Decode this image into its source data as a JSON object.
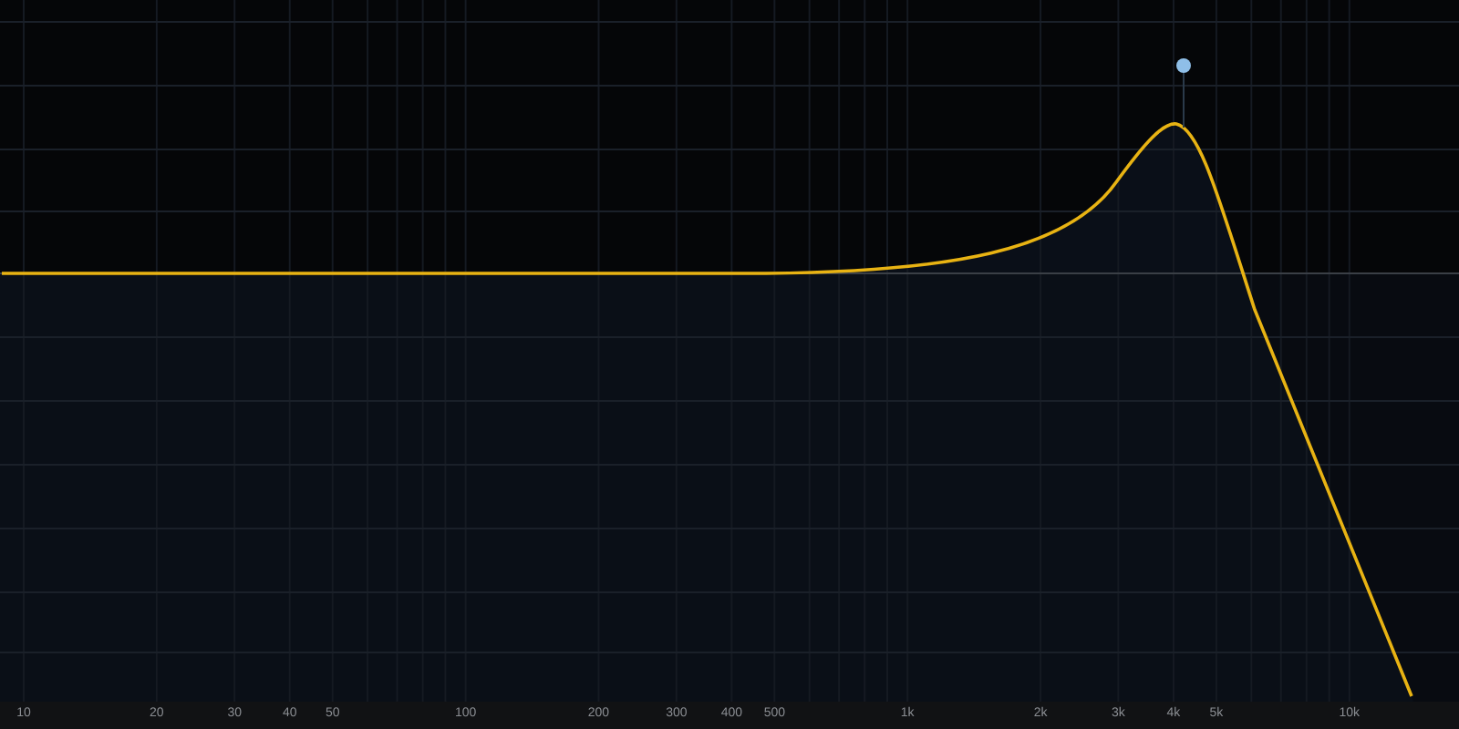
{
  "frequency_axis": {
    "labels": [
      "10",
      "20",
      "30",
      "40",
      "50",
      "100",
      "200",
      "300",
      "400",
      "500",
      "1k",
      "2k",
      "3k",
      "4k",
      "5k",
      "10k"
    ]
  }
}
